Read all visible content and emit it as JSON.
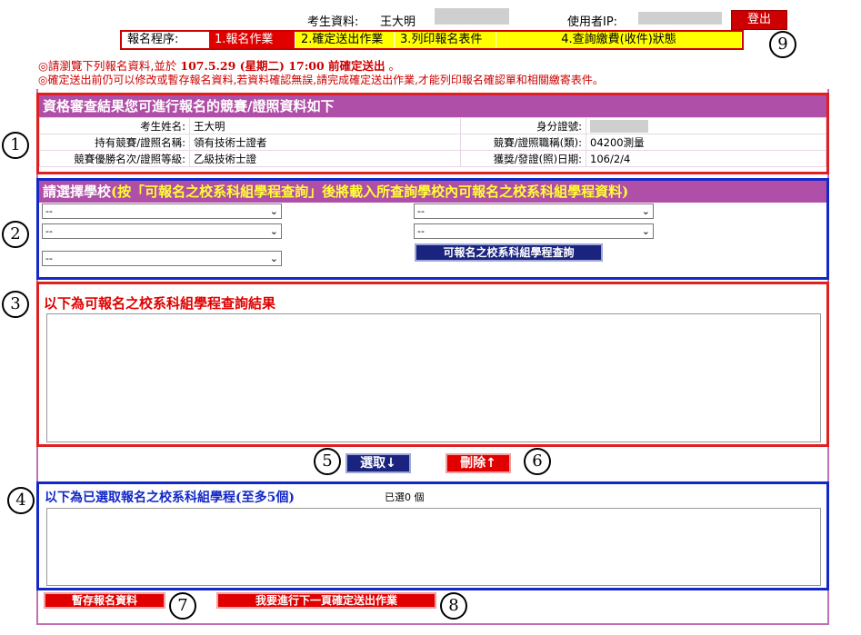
{
  "header": {
    "candidate_label": "考生資料:",
    "candidate_name": "王大明",
    "user_ip_label": "使用者IP:",
    "logout": "登出"
  },
  "steps": {
    "label": "報名程序:",
    "items": [
      "1.報名作業",
      "2.確定送出作業",
      "3.列印報名表件",
      "4.查詢繳費(收件)狀態"
    ]
  },
  "notice": {
    "line1_prefix": "◎請瀏覽下列報名資料,並於",
    "line1_deadline": "107.5.29 (星期二) 17:00 前確定送出",
    "line1_suffix": "。",
    "line2": "◎確定送出前仍可以修改或暫存報名資料,若資料確認無誤,請完成確定送出作業,才能列印報名確認單和相關繳寄表件。"
  },
  "qualification": {
    "title": "資格審查結果您可進行報名的競賽/證照資料如下",
    "rows": [
      {
        "l1": "考生姓名:",
        "v1": "王大明",
        "l2": "身分證號:",
        "v2": ""
      },
      {
        "l1": "持有競賽/證照名稱:",
        "v1": "領有技術士證者",
        "l2": "競賽/證照職稱(類):",
        "v2": "04200測量"
      },
      {
        "l1": "競賽優勝名次/證照等級:",
        "v1": "乙級技術士證",
        "l2": "獲獎/發證(照)日期:",
        "v2": "106/2/4"
      }
    ]
  },
  "school": {
    "title_prefix": "請選擇學校",
    "title_hl": "(按「可報名之校系科組學程查詢」後將載入所查詢學校內可報名之校系科組學程資料)",
    "select_value": "--",
    "query_button": "可報名之校系科組學程查詢"
  },
  "results": {
    "title": "以下為可報名之校系科組學程查詢結果"
  },
  "actions": {
    "select": "選取↓",
    "delete": "刪除↑"
  },
  "selected": {
    "title": "以下為已選取報名之校系科組學程(至多5個)",
    "count": "已選0 個"
  },
  "footer": {
    "save": "暫存報名資料",
    "next": "我要進行下一頁確定送出作業"
  },
  "markers": [
    "1",
    "2",
    "3",
    "4",
    "5",
    "6",
    "7",
    "8",
    "9"
  ],
  "icons": {
    "chevron": "chevron-down-icon"
  },
  "colors": {
    "bar": "#b04fa8",
    "red_box": "#e02020",
    "blue_box": "#1428c8",
    "accent_red": "#e00000",
    "navy": "#1a237e"
  }
}
